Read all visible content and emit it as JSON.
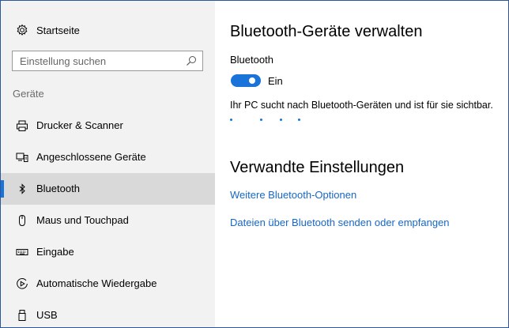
{
  "sidebar": {
    "home_label": "Startseite",
    "search_placeholder": "Einstellung suchen",
    "section_label": "Geräte",
    "items": [
      {
        "label": "Drucker & Scanner",
        "icon": "printer-icon"
      },
      {
        "label": "Angeschlossene Geräte",
        "icon": "devices-icon"
      },
      {
        "label": "Bluetooth",
        "icon": "bluetooth-icon",
        "selected": true
      },
      {
        "label": "Maus und Touchpad",
        "icon": "mouse-icon"
      },
      {
        "label": "Eingabe",
        "icon": "keyboard-icon"
      },
      {
        "label": "Automatische Wiedergabe",
        "icon": "autoplay-icon"
      },
      {
        "label": "USB",
        "icon": "usb-icon"
      }
    ]
  },
  "main": {
    "title": "Bluetooth-Geräte verwalten",
    "bluetooth_label": "Bluetooth",
    "toggle_state": "Ein",
    "toggle_on": true,
    "status_text": "Ihr PC sucht nach Bluetooth-Geräten und ist für sie sichtbar.",
    "related_title": "Verwandte Einstellungen",
    "links": [
      "Weitere Bluetooth-Optionen",
      "Dateien über Bluetooth senden oder empfangen"
    ]
  },
  "colors": {
    "accent": "#1a73d9",
    "link": "#1667c7",
    "sidebar_bg": "#f2f2f2",
    "selected_bg": "#d9d9d9"
  }
}
